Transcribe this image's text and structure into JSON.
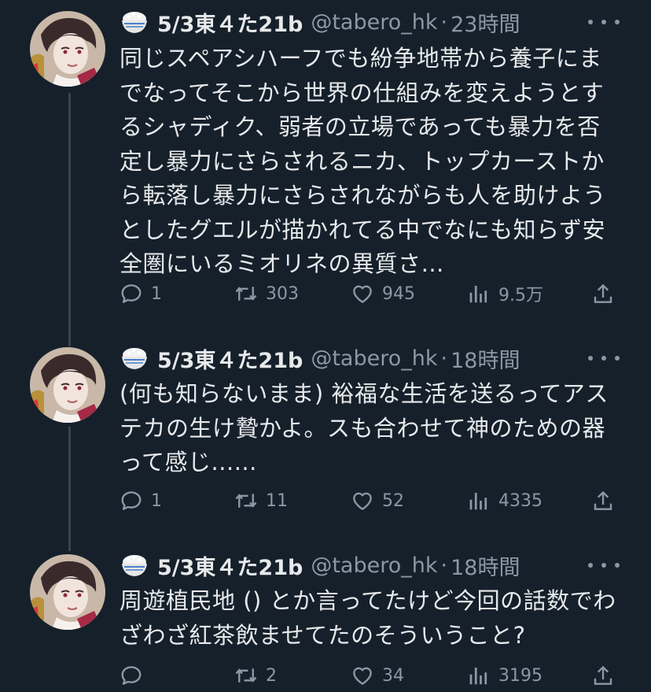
{
  "tweets": [
    {
      "display_name": "5/3東４た21b",
      "handle": "@tabero_hk",
      "separator": "·",
      "time": "23時間",
      "text": "同じスペアシハーフでも紛争地帯から養子にまでなってそこから世界の仕組みを変えようとするシャディク、弱者の立場であっても暴力を否定し暴力にさらされるニカ、トップカーストから転落し暴力にさらされながらも人を助けようとしたグエルが描かれてる中でなにも知らず安全圏にいるミオリネの異質さ…",
      "replies": "1",
      "retweets": "303",
      "likes": "945",
      "views": "9.5万"
    },
    {
      "display_name": "5/3東４た21b",
      "handle": "@tabero_hk",
      "separator": "·",
      "time": "18時間",
      "text": "(何も知らないまま) 裕福な生活を送るってアステカの生け贄かよ。スも合わせて神のための器って感じ......",
      "replies": "1",
      "retweets": "11",
      "likes": "52",
      "views": "4335"
    },
    {
      "display_name": "5/3東４た21b",
      "handle": "@tabero_hk",
      "separator": "·",
      "time": "18時間",
      "text": "周遊植民地 () とか言ってたけど今回の話数でわざわざ紅茶飲ませてたのそういうこと?",
      "replies": "",
      "retweets": "2",
      "likes": "34",
      "views": "3195"
    }
  ],
  "icons": {
    "rice": "rice-bowl-icon",
    "reply": "reply-icon",
    "retweet": "retweet-icon",
    "like": "heart-icon",
    "views": "views-icon",
    "share": "share-icon",
    "more": "more-icon"
  },
  "colors": {
    "background": "#15202b",
    "text": "#e7e9ea",
    "secondary": "#8b98a5",
    "thread_line": "#38444d"
  }
}
